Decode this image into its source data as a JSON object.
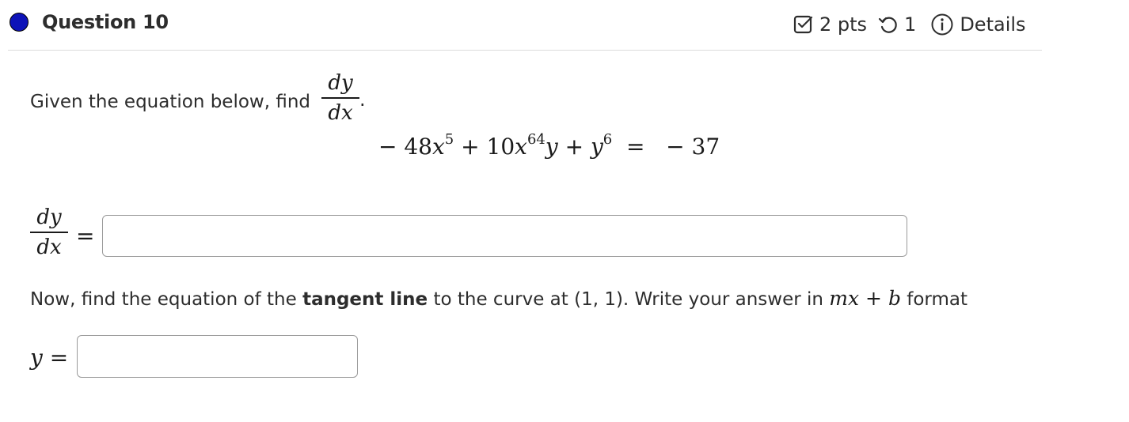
{
  "header": {
    "title": "Question 10",
    "points": "2 pts",
    "attempts": "1",
    "details": "Details",
    "status_color": "#0e13b8"
  },
  "question": {
    "prompt": "Given the equation below, find",
    "deriv_num": "dy",
    "deriv_den": "dx",
    "period": ".",
    "equation": {
      "lead": "− 48",
      "x1": "x",
      "p1": "5",
      "plus1": " + 10",
      "x2": "x",
      "p2": "64",
      "y1": "y",
      "plus2": " + ",
      "y2": "y",
      "p3": "6",
      "rhs": "  =   − 37"
    }
  },
  "answer1": {
    "num": "dy",
    "den": "dx",
    "equals": "="
  },
  "tangent": {
    "before": "Now, find the equation of the ",
    "bold": "tangent line",
    "after": " to the curve at (1, 1). Write your answer in ",
    "m": "mx",
    "plus": " + ",
    "b": "b",
    "end": " format"
  },
  "answer2": {
    "var": "y",
    "equals": " ="
  },
  "icons": {
    "points": "checkbox-icon",
    "attempts": "retry-icon",
    "details": "info-icon"
  }
}
